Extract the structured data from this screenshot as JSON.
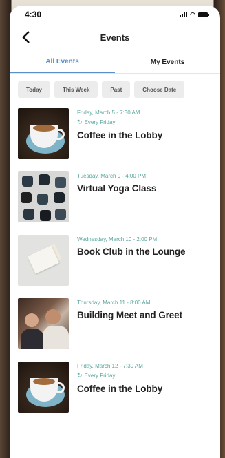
{
  "status_bar": {
    "time": "4:30"
  },
  "header": {
    "title": "Events"
  },
  "tabs": [
    {
      "label": "All Events",
      "active": true
    },
    {
      "label": "My Events",
      "active": false
    }
  ],
  "filters": [
    "Today",
    "This Week",
    "Past",
    "Choose Date"
  ],
  "colors": {
    "accent": "#5a8fc8",
    "date_text": "#5aa69c"
  },
  "events": [
    {
      "date": "Friday, March 5 - 7:30 AM",
      "recurrence": "Every Friday",
      "name": "Coffee in the Lobby",
      "image": "coffee"
    },
    {
      "date": "Tuesday, March 9 - 4:00 PM",
      "recurrence": "",
      "name": "Virtual Yoga Class",
      "image": "yoga"
    },
    {
      "date": "Wednesday, March 10 - 2:00 PM",
      "recurrence": "",
      "name": "Book Club in the Lounge",
      "image": "book"
    },
    {
      "date": "Thursday, March 11 - 8:00 AM",
      "recurrence": "",
      "name": "Building Meet and Greet",
      "image": "meet"
    },
    {
      "date": "Friday, March 12 - 7:30 AM",
      "recurrence": "Every Friday",
      "name": "Coffee in the Lobby",
      "image": "coffee"
    }
  ]
}
